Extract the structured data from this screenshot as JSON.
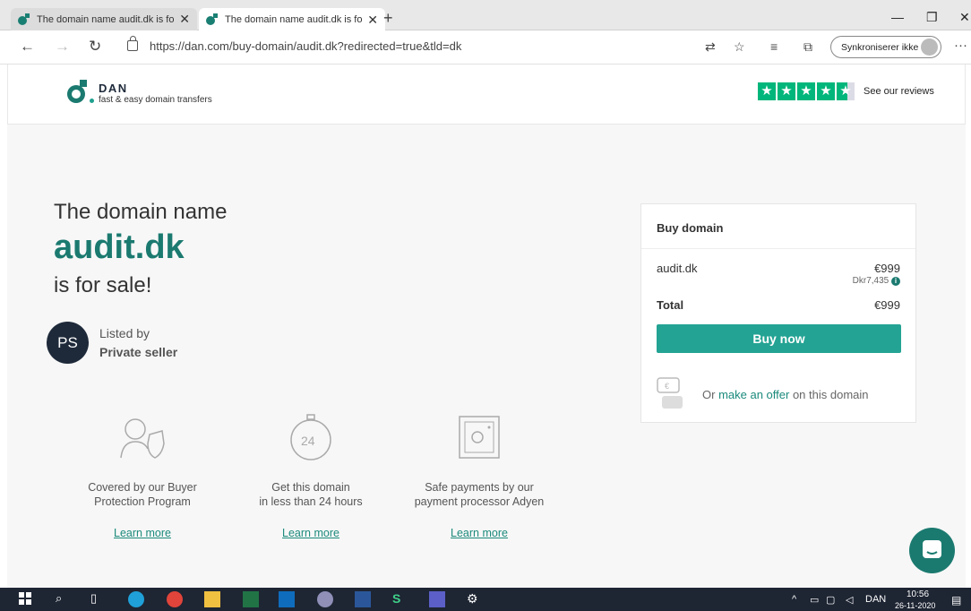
{
  "browser": {
    "tabs": [
      {
        "title": "The domain name audit.dk is for",
        "close": "✕"
      },
      {
        "title": "The domain name audit.dk is for",
        "close": "✕"
      }
    ],
    "new_tab": "+",
    "window_controls": {
      "minimize": "—",
      "restore": "❐",
      "close": "✕"
    },
    "nav": {
      "back": "←",
      "forward": "→",
      "refresh": "↻"
    },
    "url": "https://dan.com/buy-domain/audit.dk?redirected=true&tld=dk",
    "toolbar_icons": [
      "translate-icon",
      "favorite-star-icon",
      "favorites-list-icon",
      "collections-icon"
    ],
    "sync_label": "Synkroniserer ikke",
    "more": "···"
  },
  "header": {
    "brand": "DAN",
    "tagline": "fast & easy domain transfers",
    "rating_stars": 4.5,
    "reviews_link": "See our reviews",
    "accent_color": "#00b67a"
  },
  "hero": {
    "lead": "The domain name",
    "domain": "audit.dk",
    "sale": "is for sale!",
    "seller_initials": "PS",
    "listed_by": "Listed by",
    "seller_name": "Private seller"
  },
  "features": [
    {
      "icon": "buyer-protection-icon",
      "line1": "Covered by our Buyer",
      "line2": "Protection Program",
      "link": "Learn more"
    },
    {
      "icon": "24-hour-clock-icon",
      "line1": "Get this domain",
      "line2": "in less than 24 hours",
      "link": "Learn more"
    },
    {
      "icon": "safe-payment-icon",
      "line1": "Safe payments by our",
      "line2": "payment processor Adyen",
      "link": "Learn more"
    }
  ],
  "card": {
    "title": "Buy domain",
    "item": "audit.dk",
    "price": "€999",
    "local_price": "Dkr7,435",
    "total_label": "Total",
    "total": "€999",
    "buy_button": "Buy now",
    "offer_prefix": "Or ",
    "offer_link": "make an offer",
    "offer_suffix": " on this domain",
    "brand_color": "#1b7a70",
    "button_color": "#23a393"
  },
  "chat_icon": "chat-bubble-icon",
  "taskbar": {
    "apps": [
      "windows-start-icon",
      "search-icon",
      "task-view-icon",
      "edge-icon",
      "chrome-icon",
      "file-explorer-icon",
      "excel-icon",
      "outlook-icon",
      "app-icon",
      "word-icon",
      "skype-icon",
      "teams-icon",
      "settings-icon"
    ],
    "language": "DAN",
    "time": "10:56",
    "date": "26-11-2020"
  }
}
